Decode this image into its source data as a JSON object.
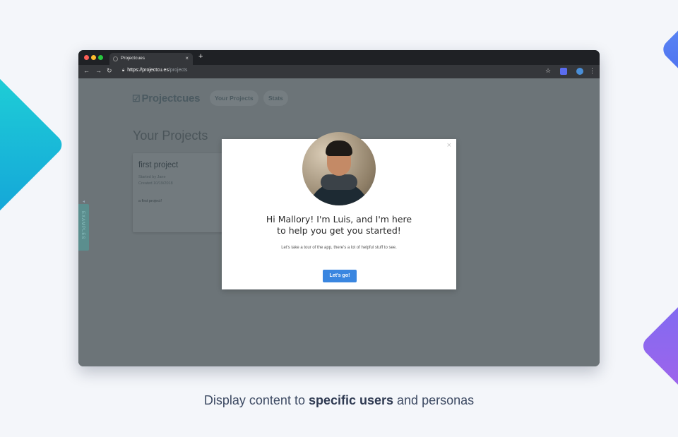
{
  "browser": {
    "tab_title": "Projectcues",
    "tab_close": "×",
    "new_tab": "+",
    "url_host": "https://projectcu.es",
    "url_path": "/projects",
    "nav": {
      "back": "←",
      "forward": "→",
      "reload": "↻"
    }
  },
  "app": {
    "logo": "Projectcues",
    "nav": [
      "Your Projects",
      "Stats"
    ],
    "page_title": "Your Projects",
    "card": {
      "title": "first project",
      "started_by": "Started by Jane",
      "created": "Created 10/19/2018",
      "description": "a first project!"
    },
    "side_tab": "EXAMPLES"
  },
  "modal": {
    "close": "×",
    "heading_line1": "Hi Mallory! I'm Luis, and I'm here",
    "heading_line2": "to help you get you started!",
    "subtext": "Let's take a tour of the app, there's a lot of helpful stuff to see.",
    "button": "Let's go!"
  },
  "caption": {
    "before": "Display content to ",
    "bold": "specific users",
    "after": " and personas"
  },
  "colors": {
    "accent": "#3a86e0",
    "page_bg": "#f4f6fa",
    "overlay": "#6c7478"
  }
}
